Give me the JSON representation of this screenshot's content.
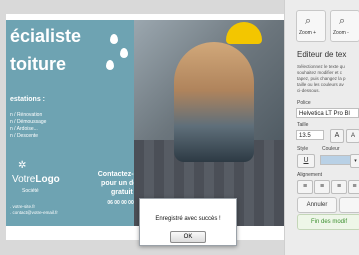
{
  "document": {
    "title_line1": "écialiste",
    "title_line2": "toiture",
    "prestations_heading": "estations :",
    "services": [
      "n / Rénovation",
      "n / Démoussage",
      "n / Ardoise...",
      "n / Descente"
    ],
    "logo_text_light": "Votre",
    "logo_text_bold": "Logo",
    "societe": "Société",
    "contact_lines": [
      ". votre-site.fr",
      ". contact@votre-email.fr"
    ],
    "cta": "Contactez-nous pour un devis gratuit !",
    "cta_phone": "06 00 00 00 00"
  },
  "sidebar": {
    "zoom_in_label": "Zoom +",
    "zoom_out_label": "Zoom -",
    "editor_title": "Editeur de tex",
    "editor_desc": [
      "Sélectionnez le texte qu",
      "souhaitez modifier et c",
      "tapez, puis changez la p",
      "taille ou les couleurs av",
      "ci-dessous."
    ],
    "police_label": "Police",
    "police_value": "Helvetica LT Pro Bl",
    "taille_label": "Taille",
    "taille_value": "13.5",
    "style_label": "Style",
    "couleur_label": "Couleur",
    "alignement_label": "Alignement",
    "annuler_label": "Annuler",
    "fin_label": "Fin des modif"
  },
  "dialog": {
    "message": "Enregistré avec succès !",
    "ok_label": "OK"
  },
  "colors": {
    "panel": "#6ea3b2",
    "helmet": "#f3c600",
    "green_text": "#3b8f2e"
  }
}
